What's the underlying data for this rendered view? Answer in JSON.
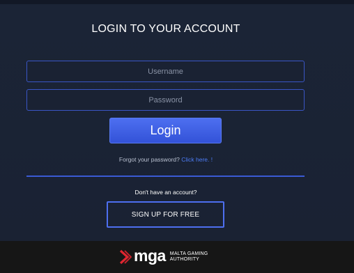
{
  "login": {
    "title": "LOGIN TO YOUR ACCOUNT",
    "username_placeholder": "Username",
    "password_placeholder": "Password",
    "login_button": "Login",
    "forgot_text": "Forgot your password?",
    "forgot_link": "Click here. !",
    "no_account_text": "Don't have an account?",
    "signup_button": "SIGN UP FOR FREE"
  },
  "footer": {
    "logo_word": "mga",
    "logo_line1": "MALTA GAMING",
    "logo_line2": "AUTHORITY",
    "logo_icon": "mga-arrow-icon"
  },
  "colors": {
    "accent": "#4d6ff0",
    "link": "#4c7cf5",
    "mga_red": "#e02630",
    "background": "#1b2436"
  }
}
